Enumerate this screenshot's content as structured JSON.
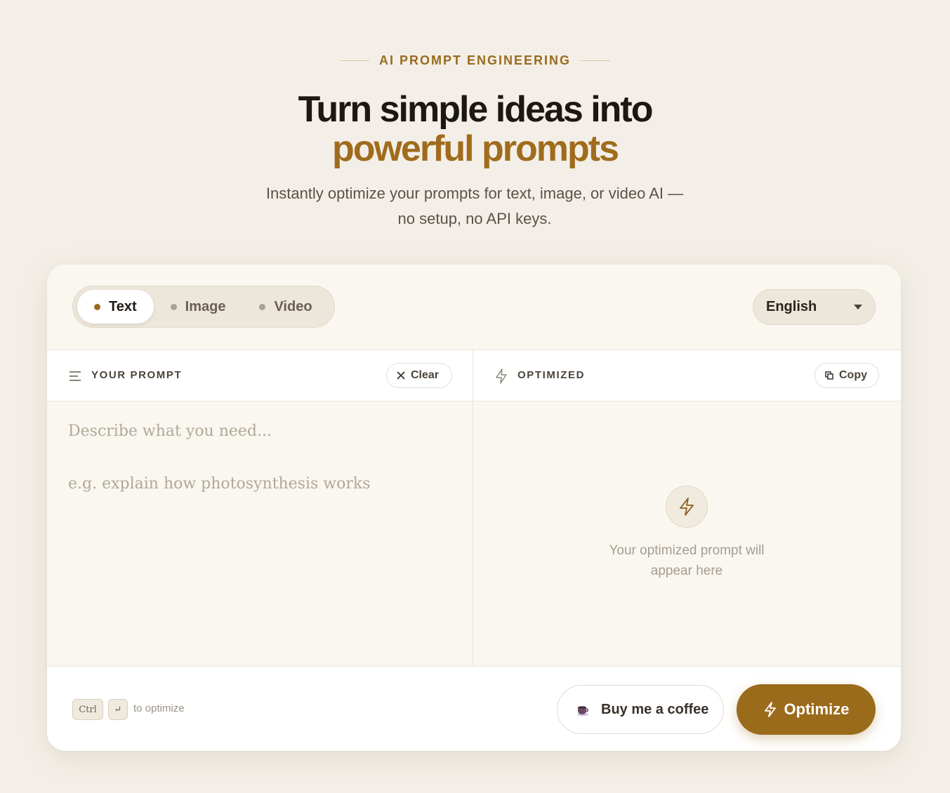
{
  "hero": {
    "eyebrow": "AI PROMPT ENGINEERING",
    "title_line1": "Turn simple ideas into",
    "title_line2": "powerful prompts",
    "subtitle_line1": "Instantly optimize your prompts for text, image, or video AI —",
    "subtitle_line2": "no setup, no API keys."
  },
  "mode_tabs": [
    {
      "label": "Text",
      "active": true
    },
    {
      "label": "Image",
      "active": false
    },
    {
      "label": "Video",
      "active": false
    }
  ],
  "language": {
    "selected": "English"
  },
  "input_panel": {
    "label": "YOUR PROMPT",
    "clear_label": "Clear",
    "placeholder": "Describe what you need...",
    "example": "e.g.  explain how photosynthesis works"
  },
  "output_panel": {
    "label": "OPTIMIZED",
    "copy_label": "Copy",
    "empty_line1": "Your optimized prompt will",
    "empty_line2": "appear here"
  },
  "footer": {
    "key1": "Ctrl",
    "key2": "↵",
    "hint": "to optimize",
    "coffee_label": "Buy me a coffee",
    "optimize_label": "Optimize"
  },
  "colors": {
    "accent": "#9b6b1c",
    "background": "#f3efe8",
    "card": "#faf7f1"
  }
}
